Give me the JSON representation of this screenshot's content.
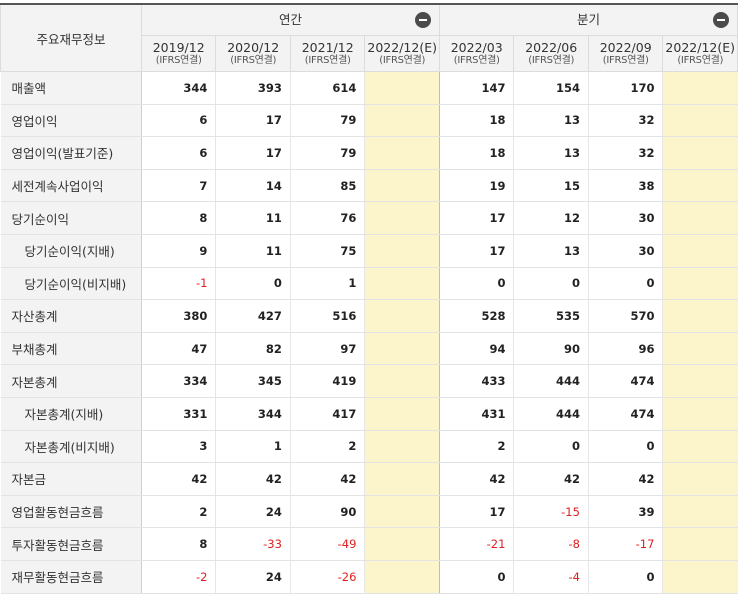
{
  "header": {
    "label": "주요재무정보",
    "annual": "연간",
    "quarterly": "분기",
    "columns": [
      {
        "year": "2019/12",
        "basis": "(IFRS연결)"
      },
      {
        "year": "2020/12",
        "basis": "(IFRS연결)"
      },
      {
        "year": "2021/12",
        "basis": "(IFRS연결)"
      },
      {
        "year": "2022/12(E)",
        "basis": "(IFRS연결)"
      },
      {
        "year": "2022/03",
        "basis": "(IFRS연결)"
      },
      {
        "year": "2022/06",
        "basis": "(IFRS연결)"
      },
      {
        "year": "2022/09",
        "basis": "(IFRS연결)"
      },
      {
        "year": "2022/12(E)",
        "basis": "(IFRS연결)"
      }
    ]
  },
  "rows": [
    {
      "label": "매출액",
      "sub": false,
      "values": [
        "344",
        "393",
        "614",
        "",
        "147",
        "154",
        "170",
        ""
      ]
    },
    {
      "label": "영업이익",
      "sub": false,
      "values": [
        "6",
        "17",
        "79",
        "",
        "18",
        "13",
        "32",
        ""
      ]
    },
    {
      "label": "영업이익(발표기준)",
      "sub": false,
      "values": [
        "6",
        "17",
        "79",
        "",
        "18",
        "13",
        "32",
        ""
      ]
    },
    {
      "label": "세전계속사업이익",
      "sub": false,
      "values": [
        "7",
        "14",
        "85",
        "",
        "19",
        "15",
        "38",
        ""
      ]
    },
    {
      "label": "당기순이익",
      "sub": false,
      "values": [
        "8",
        "11",
        "76",
        "",
        "17",
        "12",
        "30",
        ""
      ]
    },
    {
      "label": "당기순이익(지배)",
      "sub": true,
      "values": [
        "9",
        "11",
        "75",
        "",
        "17",
        "13",
        "30",
        ""
      ]
    },
    {
      "label": "당기순이익(비지배)",
      "sub": true,
      "values": [
        "-1",
        "0",
        "1",
        "",
        "0",
        "0",
        "0",
        ""
      ]
    },
    {
      "label": "자산총계",
      "sub": false,
      "values": [
        "380",
        "427",
        "516",
        "",
        "528",
        "535",
        "570",
        ""
      ]
    },
    {
      "label": "부채총계",
      "sub": false,
      "values": [
        "47",
        "82",
        "97",
        "",
        "94",
        "90",
        "96",
        ""
      ]
    },
    {
      "label": "자본총계",
      "sub": false,
      "values": [
        "334",
        "345",
        "419",
        "",
        "433",
        "444",
        "474",
        ""
      ]
    },
    {
      "label": "자본총계(지배)",
      "sub": true,
      "values": [
        "331",
        "344",
        "417",
        "",
        "431",
        "444",
        "474",
        ""
      ]
    },
    {
      "label": "자본총계(비지배)",
      "sub": true,
      "values": [
        "3",
        "1",
        "2",
        "",
        "2",
        "0",
        "0",
        ""
      ]
    },
    {
      "label": "자본금",
      "sub": false,
      "values": [
        "42",
        "42",
        "42",
        "",
        "42",
        "42",
        "42",
        ""
      ]
    },
    {
      "label": "영업활동현금흐름",
      "sub": false,
      "values": [
        "2",
        "24",
        "90",
        "",
        "17",
        "-15",
        "39",
        ""
      ]
    },
    {
      "label": "투자활동현금흐름",
      "sub": false,
      "values": [
        "8",
        "-33",
        "-49",
        "",
        "-21",
        "-8",
        "-17",
        ""
      ]
    },
    {
      "label": "재무활동현금흐름",
      "sub": false,
      "values": [
        "-2",
        "24",
        "-26",
        "",
        "0",
        "-4",
        "0",
        ""
      ]
    }
  ],
  "colors": {
    "negative": "#e02020",
    "estimate_bg": "#fcf5cc",
    "label_bg": "#f3f3f3"
  }
}
